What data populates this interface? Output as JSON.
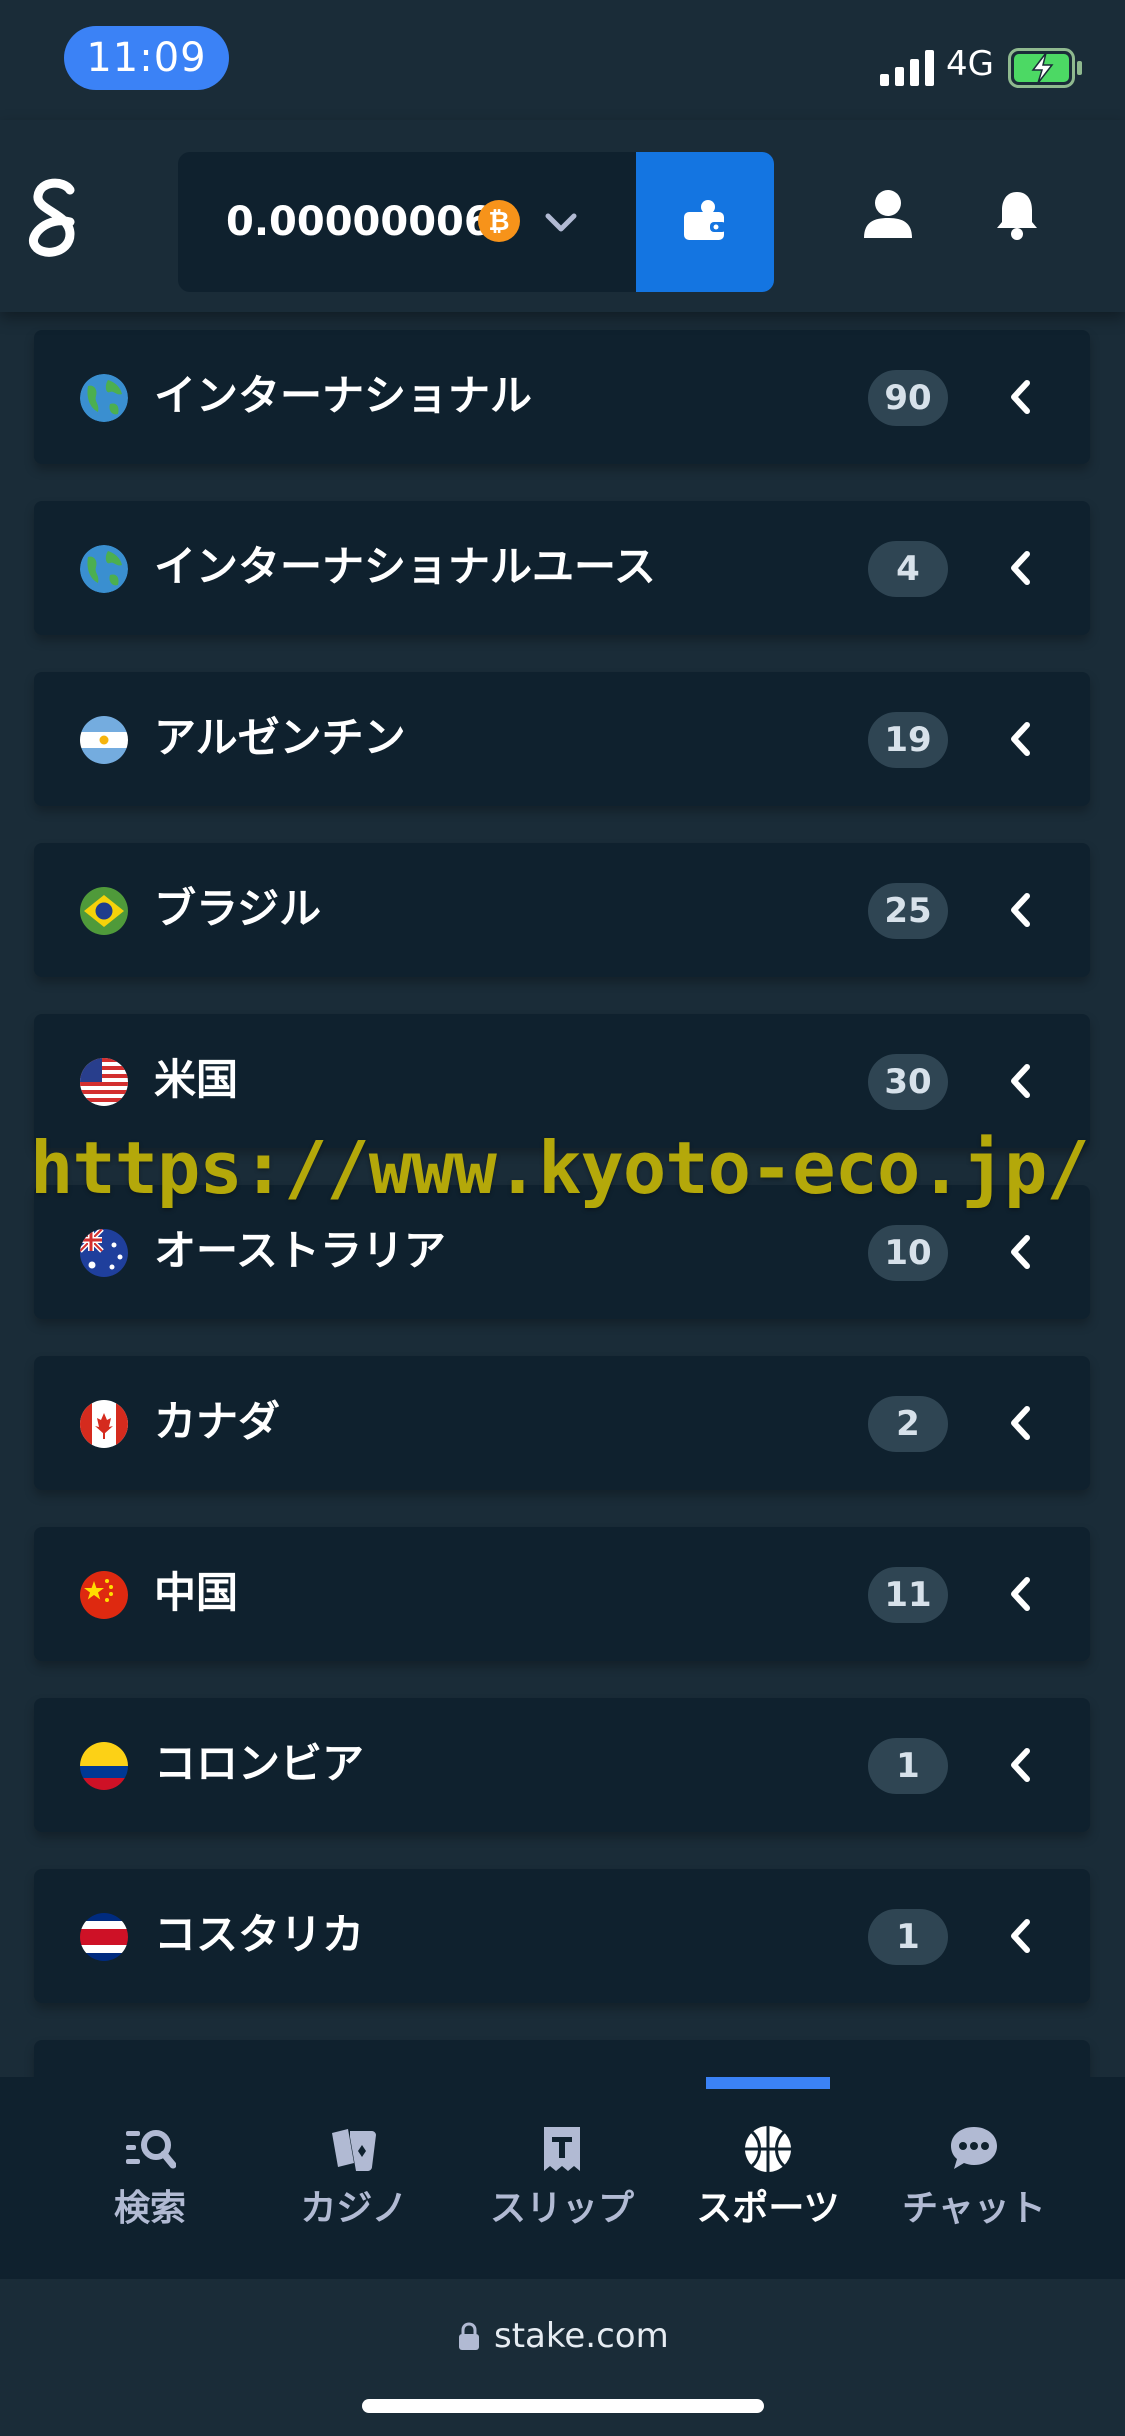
{
  "status_bar": {
    "time": "11:09",
    "network": "4G"
  },
  "header": {
    "balance": "0.00000006",
    "currency_icon": "bitcoin-icon",
    "wallet_icon": "wallet-icon",
    "user_icon": "user-icon",
    "bell_icon": "bell-icon"
  },
  "countries": [
    {
      "label": "インターナショナル",
      "count": "90",
      "flag": "globe"
    },
    {
      "label": "インターナショナルユース",
      "count": "4",
      "flag": "globe"
    },
    {
      "label": "アルゼンチン",
      "count": "19",
      "flag": "argentina"
    },
    {
      "label": "ブラジル",
      "count": "25",
      "flag": "brazil"
    },
    {
      "label": "米国",
      "count": "30",
      "flag": "usa"
    },
    {
      "label": "オーストラリア",
      "count": "10",
      "flag": "australia"
    },
    {
      "label": "カナダ",
      "count": "2",
      "flag": "canada"
    },
    {
      "label": "中国",
      "count": "11",
      "flag": "china"
    },
    {
      "label": "コロンビア",
      "count": "1",
      "flag": "colombia"
    },
    {
      "label": "コスタリカ",
      "count": "1",
      "flag": "costa-rica"
    }
  ],
  "watermark": "https://www.kyoto-eco.jp/",
  "bottom_nav": {
    "items": [
      {
        "label": "検索",
        "icon": "search-icon"
      },
      {
        "label": "カジノ",
        "icon": "cards-icon"
      },
      {
        "label": "スリップ",
        "icon": "betslip-icon"
      },
      {
        "label": "スポーツ",
        "icon": "basketball-icon"
      },
      {
        "label": "チャット",
        "icon": "chat-icon"
      }
    ],
    "active_index": 3
  },
  "browser": {
    "url": "stake.com"
  },
  "colors": {
    "background": "#1a2c38",
    "card": "#0f212e",
    "accent": "#1475e1",
    "badge": "#2f4553"
  }
}
